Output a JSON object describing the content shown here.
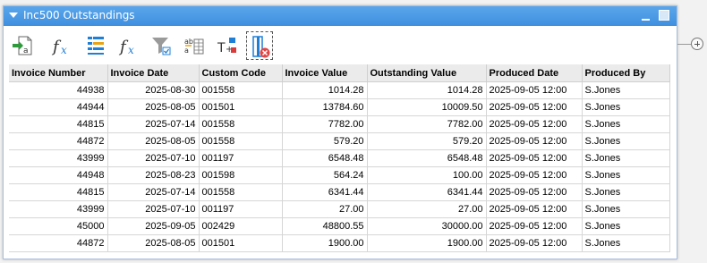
{
  "window": {
    "title": "Inc500 Outstandings"
  },
  "toolbar": {
    "buttons": [
      {
        "name": "export-icon"
      },
      {
        "name": "function-icon"
      },
      {
        "name": "column-list-icon"
      },
      {
        "name": "function-alt-icon"
      },
      {
        "name": "filter-icon"
      },
      {
        "name": "sort-icon"
      },
      {
        "name": "text-format-icon"
      },
      {
        "name": "clear-columns-icon"
      }
    ]
  },
  "grid": {
    "columns": [
      "Invoice Number",
      "Invoice Date",
      "Custom Code",
      "Invoice Value",
      "Outstanding Value",
      "Produced Date",
      "Produced By"
    ],
    "rows": [
      [
        "44938",
        "2025-08-30",
        "001558",
        "1014.28",
        "1014.28",
        "2025-09-05 12:00",
        "S.Jones"
      ],
      [
        "44944",
        "2025-08-05",
        "001501",
        "13784.60",
        "10009.50",
        "2025-09-05 12:00",
        "S.Jones"
      ],
      [
        "44815",
        "2025-07-14",
        "001558",
        "7782.00",
        "7782.00",
        "2025-09-05 12:00",
        "S.Jones"
      ],
      [
        "44872",
        "2025-08-05",
        "001558",
        "579.20",
        "579.20",
        "2025-09-05 12:00",
        "S.Jones"
      ],
      [
        "43999",
        "2025-07-10",
        "001197",
        "6548.48",
        "6548.48",
        "2025-09-05 12:00",
        "S.Jones"
      ],
      [
        "44948",
        "2025-08-23",
        "001598",
        "564.24",
        "100.00",
        "2025-09-05 12:00",
        "S.Jones"
      ],
      [
        "44815",
        "2025-07-14",
        "001558",
        "6341.44",
        "6341.44",
        "2025-09-05 12:00",
        "S.Jones"
      ],
      [
        "43999",
        "2025-07-10",
        "001197",
        "27.00",
        "27.00",
        "2025-09-05 12:00",
        "S.Jones"
      ],
      [
        "45000",
        "2025-09-05",
        "002429",
        "48800.55",
        "30000.00",
        "2025-09-05 12:00",
        "S.Jones"
      ],
      [
        "44872",
        "2025-08-05",
        "001501",
        "1900.00",
        "1900.00",
        "2025-09-05 12:00",
        "S.Jones"
      ]
    ]
  },
  "colors": {
    "titlebar": "#4a9be6",
    "header_bg": "#ebebeb",
    "accent": "#1f7fd6"
  }
}
